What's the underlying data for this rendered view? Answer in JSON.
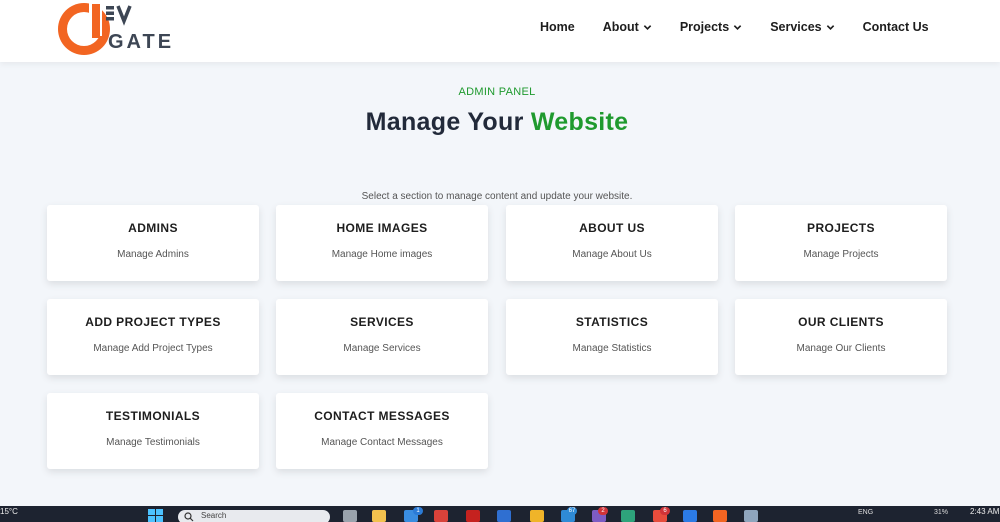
{
  "header": {
    "logo_text": "DEVGATE",
    "nav": [
      {
        "label": "Home",
        "dropdown": false
      },
      {
        "label": "About",
        "dropdown": true
      },
      {
        "label": "Projects",
        "dropdown": true
      },
      {
        "label": "Services",
        "dropdown": true
      },
      {
        "label": "Contact Us",
        "dropdown": false
      }
    ]
  },
  "hero": {
    "eyebrow": "ADMIN PANEL",
    "title_prefix": "Manage Your ",
    "title_accent": "Website",
    "subtitle": "Select a section to manage content and update your website."
  },
  "cards": [
    {
      "title": "ADMINS",
      "desc": "Manage Admins"
    },
    {
      "title": "HOME IMAGES",
      "desc": "Manage Home images"
    },
    {
      "title": "ABOUT US",
      "desc": "Manage About Us"
    },
    {
      "title": "PROJECTS",
      "desc": "Manage Projects"
    },
    {
      "title": "ADD PROJECT TYPES",
      "desc": "Manage Add Project Types"
    },
    {
      "title": "SERVICES",
      "desc": "Manage Services"
    },
    {
      "title": "STATISTICS",
      "desc": "Manage Statistics"
    },
    {
      "title": "OUR CLIENTS",
      "desc": "Manage Our Clients"
    },
    {
      "title": "TESTIMONIALS",
      "desc": "Manage Testimonials"
    },
    {
      "title": "CONTACT MESSAGES",
      "desc": "Manage Contact Messages"
    }
  ],
  "taskbar": {
    "weather": "15°C",
    "search_text": "Search",
    "badges": [
      "1",
      "67",
      "2",
      "6"
    ],
    "tray_lang": "ENG",
    "tray_battery": "31%",
    "time": "2:43 AM"
  },
  "colors": {
    "accent_green": "#1f9a2e",
    "logo_orange": "#f26522",
    "logo_gray": "#3d4654",
    "page_bg": "#f3f6fa"
  }
}
